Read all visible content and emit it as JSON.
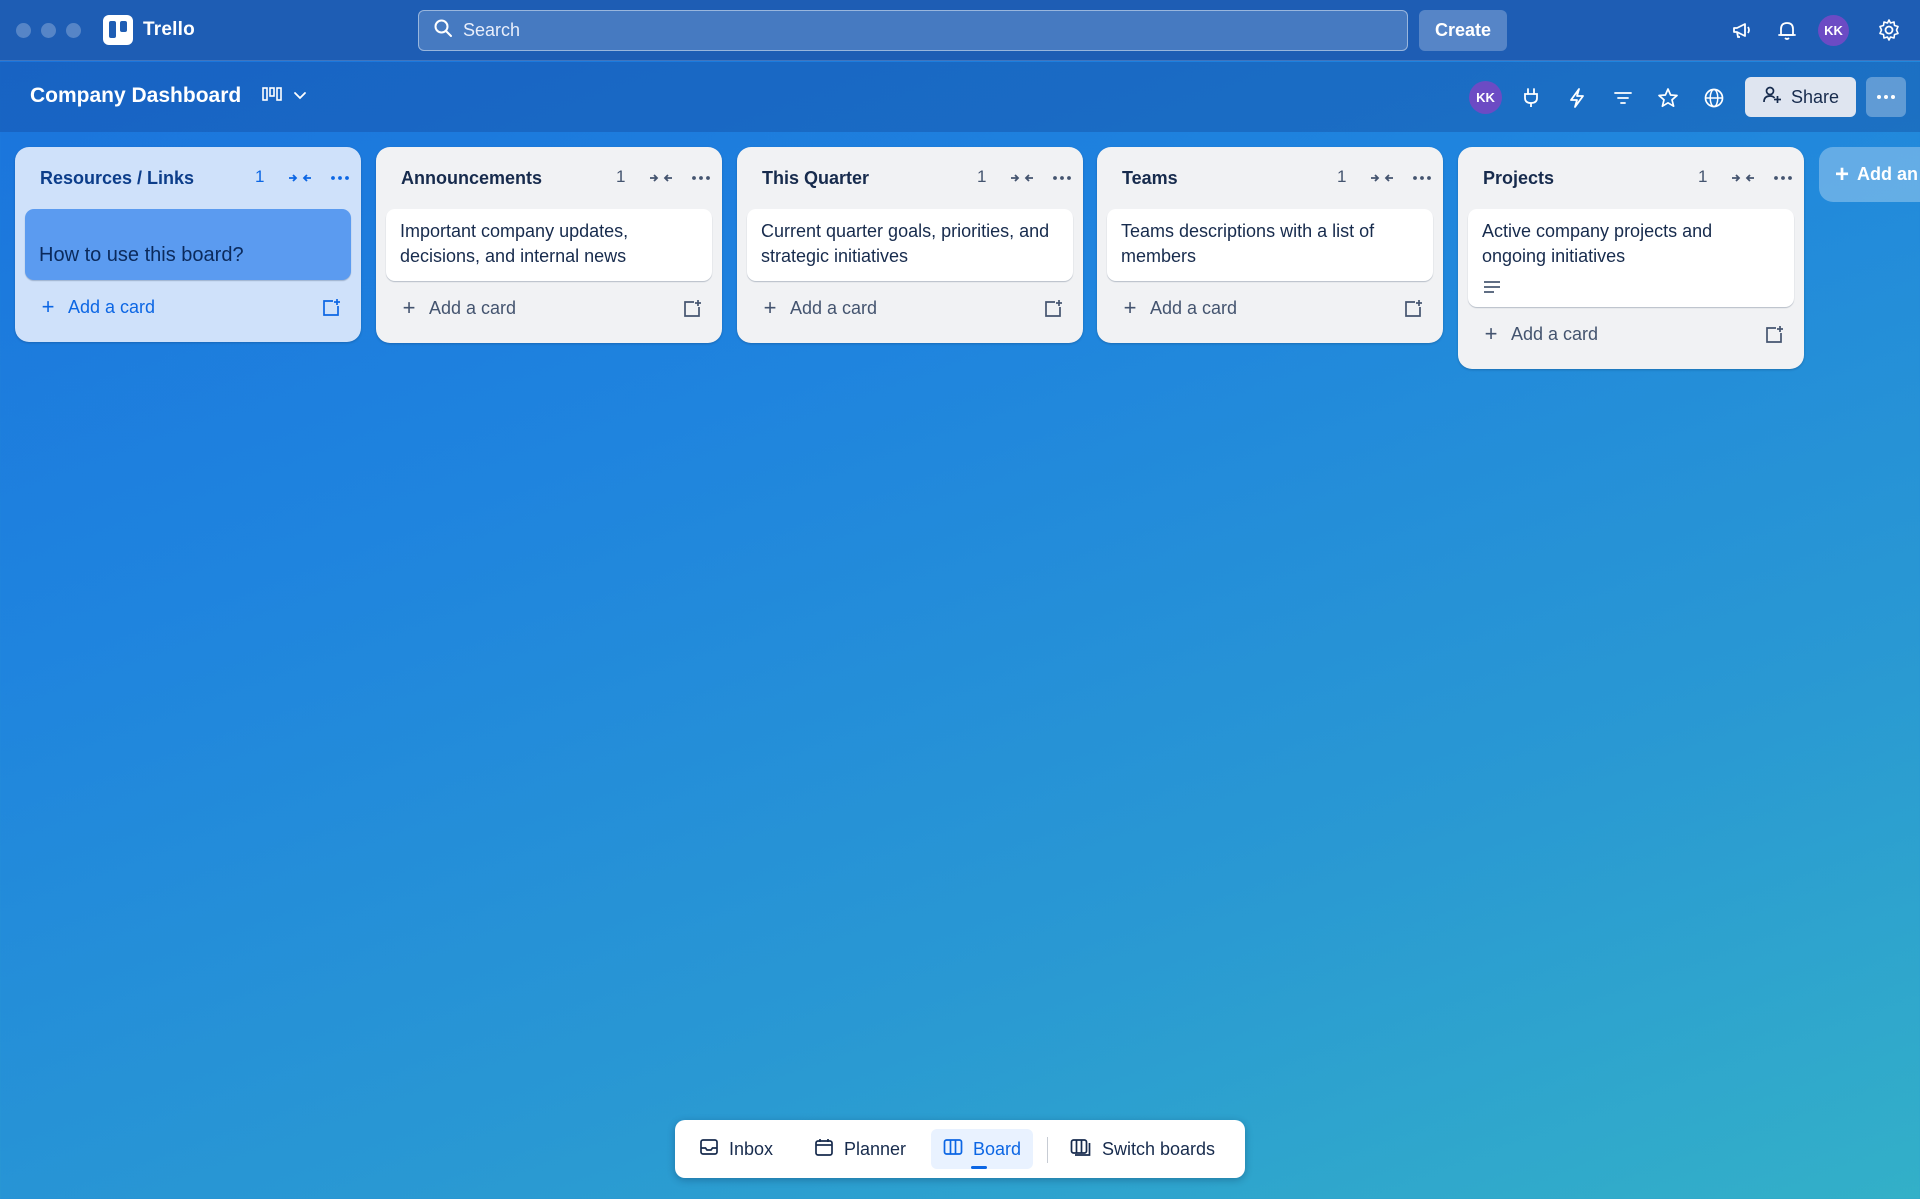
{
  "app": {
    "name": "Trello"
  },
  "search": {
    "placeholder": "Search"
  },
  "topbar": {
    "create_label": "Create",
    "avatar_initials": "KK"
  },
  "board": {
    "title": "Company Dashboard",
    "member_initials": "KK",
    "share_label": "Share"
  },
  "lists": [
    {
      "title": "Resources / Links",
      "count": "1",
      "cards": [
        "How to use this board?"
      ],
      "add_label": "Add a card"
    },
    {
      "title": "Announcements",
      "count": "1",
      "cards": [
        "Important company updates, decisions, and internal news"
      ],
      "add_label": "Add a card"
    },
    {
      "title": "This Quarter",
      "count": "1",
      "cards": [
        "Current quarter goals, priorities, and strategic initiatives"
      ],
      "add_label": "Add a card"
    },
    {
      "title": "Teams",
      "count": "1",
      "cards": [
        "Teams descriptions with a list of members"
      ],
      "add_label": "Add a card"
    },
    {
      "title": "Projects",
      "count": "1",
      "cards": [
        "Active company projects and ongoing initiatives"
      ],
      "add_label": "Add a card"
    }
  ],
  "add_list_label": "Add an",
  "dock": {
    "inbox": "Inbox",
    "planner": "Planner",
    "board": "Board",
    "switch_boards": "Switch boards"
  },
  "colors": {
    "topbar": "#1e5db4",
    "accent": "#0c66e4",
    "avatar": "#6c4bc4"
  }
}
